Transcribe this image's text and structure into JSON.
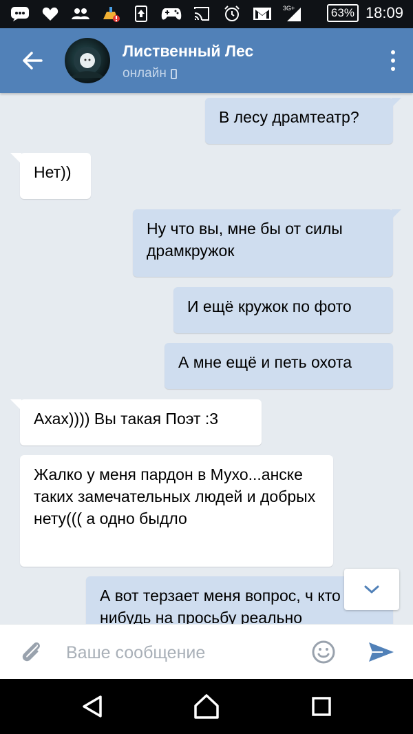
{
  "status_bar": {
    "icons": [
      "messages-icon",
      "heart-icon",
      "people-icon",
      "cleaner-icon",
      "upload-icon",
      "gamepad-icon",
      "cast-icon",
      "alarm-icon",
      "mail-icon",
      "signal-icon"
    ],
    "network": "3G+",
    "battery": "63%",
    "time": "18:09"
  },
  "header": {
    "title": "Лиственный Лес",
    "status": "онлайн",
    "accent": "#5181b8"
  },
  "messages": [
    {
      "dir": "out",
      "text": "В лесу драмтеатр?"
    },
    {
      "dir": "in",
      "text": "Нет))"
    },
    {
      "dir": "out",
      "text": "Ну что вы, мне бы от силы драмкружок"
    },
    {
      "dir": "out",
      "text": "И ещё кружок по фото"
    },
    {
      "dir": "out",
      "text": "А мне ещё и петь охота"
    },
    {
      "dir": "in",
      "text": "Ахах)))) Вы такая Поэт :3"
    },
    {
      "dir": "in",
      "text": "Жалко у меня пардон в Мухо...анске таких замечательных людей и добрых нету((( а одно быдло"
    },
    {
      "dir": "out",
      "text": "А вот терзает меня вопрос, ч кто нибудь на просьбу реально"
    }
  ],
  "composer": {
    "placeholder": "Ваше сообщение",
    "value": ""
  },
  "colors": {
    "bubble_out": "#cfddef",
    "bubble_in": "#ffffff",
    "background": "#e6ebf0"
  }
}
